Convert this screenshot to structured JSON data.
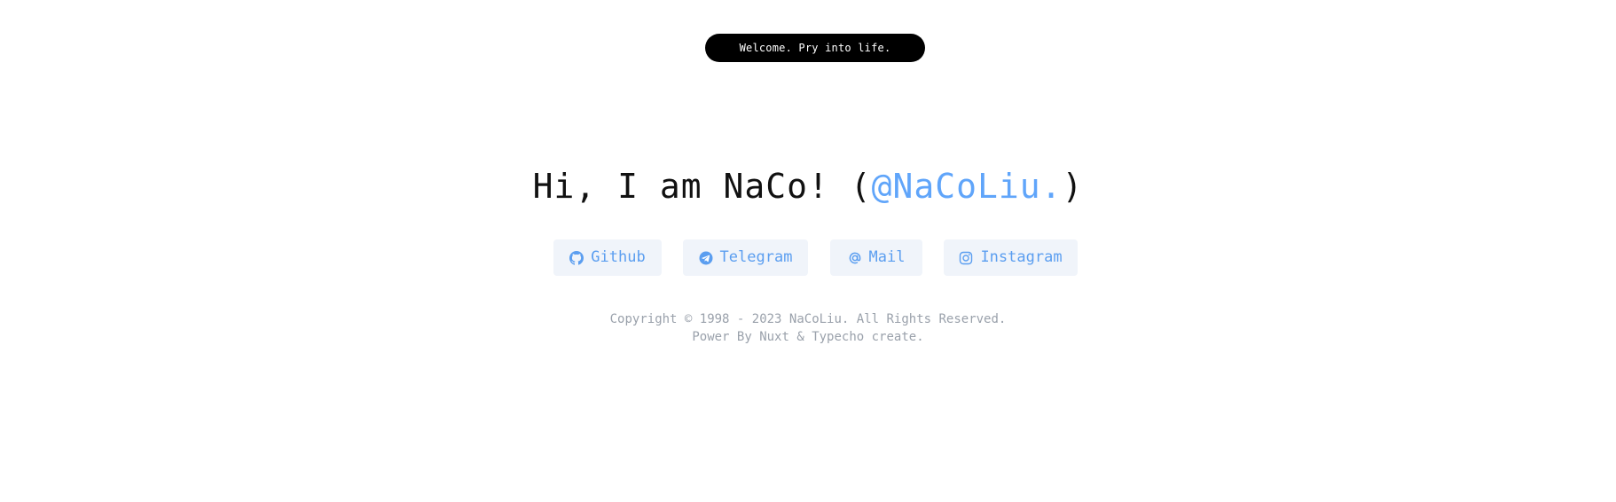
{
  "banner": {
    "text": "Welcome. Pry into life."
  },
  "hero": {
    "prefix": "Hi, I am NaCo! (",
    "handle": "@NaCoLiu.",
    "suffix": ")"
  },
  "links": [
    {
      "label": "Github",
      "icon": "github-icon"
    },
    {
      "label": "Telegram",
      "icon": "telegram-icon"
    },
    {
      "label": "Mail",
      "icon": "at-icon"
    },
    {
      "label": "Instagram",
      "icon": "instagram-icon"
    }
  ],
  "footer": {
    "copyright": "Copyright © 1998 - 2023 NaCoLiu. All Rights Reserved.",
    "powered": "Power By Nuxt & Typecho create."
  },
  "colors": {
    "accent": "#60a5fa",
    "button_bg": "#f0f4fa",
    "banner_bg": "#000000",
    "footer_text": "#9aa1ab"
  }
}
